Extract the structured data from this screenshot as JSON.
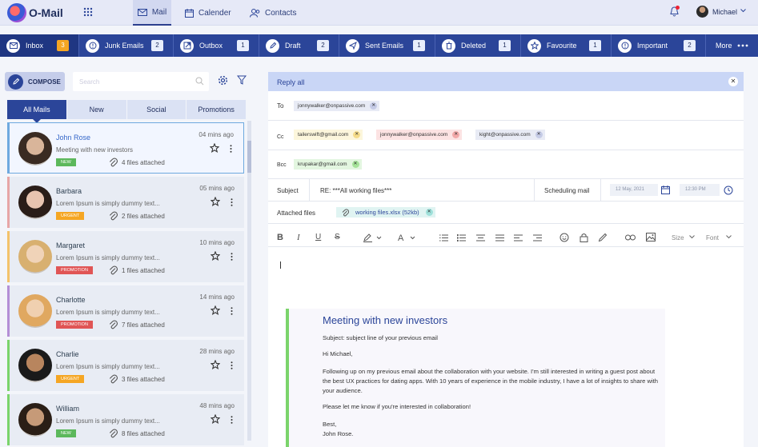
{
  "app": {
    "name": "O-Mail"
  },
  "nav": {
    "tabs": [
      {
        "label": "Mail",
        "icon": "mail-icon"
      },
      {
        "label": "Calender",
        "icon": "calendar-icon"
      },
      {
        "label": "Contacts",
        "icon": "contacts-icon"
      }
    ],
    "active": "Mail"
  },
  "user": {
    "name": "Michael"
  },
  "folders": [
    {
      "label": "Inbox",
      "count": "3",
      "icon": "inbox-icon"
    },
    {
      "label": "Junk Emails",
      "count": "2",
      "icon": "junk-icon"
    },
    {
      "label": "Outbox",
      "count": "1",
      "icon": "outbox-icon"
    },
    {
      "label": "Draft",
      "count": "2",
      "icon": "draft-icon"
    },
    {
      "label": "Sent Emails",
      "count": "1",
      "icon": "sent-icon"
    },
    {
      "label": "Deleted",
      "count": "1",
      "icon": "trash-icon"
    },
    {
      "label": "Favourite",
      "count": "1",
      "icon": "star-icon"
    },
    {
      "label": "Important",
      "count": "2",
      "icon": "important-icon"
    },
    {
      "label": "More",
      "icon": "more-dots-icon"
    }
  ],
  "left": {
    "compose_label": "COMPOSE",
    "search_placeholder": "Search",
    "tabs": [
      "All Mails",
      "New",
      "Social",
      "Promotions"
    ],
    "active_tab": "All Mails"
  },
  "emails": [
    {
      "name": "John Rose",
      "time": "04 mins ago",
      "preview": "Meeting with new investors",
      "badge": "NEW",
      "badge_color": "#5cb85c",
      "attachments": "4 files attached",
      "accent": "#6ea9df"
    },
    {
      "name": "Barbara",
      "time": "05 mins ago",
      "preview": "Lorem Ipsum is simply dummy text...",
      "badge": "URGENT",
      "badge_color": "#f5a623",
      "attachments": "2 files attached",
      "accent": "#e7a6a6"
    },
    {
      "name": "Margaret",
      "time": "10 mins ago",
      "preview": "Lorem Ipsum is simply dummy text...",
      "badge": "PROMOTION",
      "badge_color": "#e05555",
      "attachments": "1 files attached",
      "accent": "#f3c26b"
    },
    {
      "name": "Charlotte",
      "time": "14 mins ago",
      "preview": "Lorem Ipsum is simply dummy text...",
      "badge": "PROMOTION",
      "badge_color": "#e05555",
      "attachments": "7 files attached",
      "accent": "#b48fd6"
    },
    {
      "name": "Charlie",
      "time": "28 mins ago",
      "preview": "Lorem Ipsum is simply dummy text...",
      "badge": "URGENT",
      "badge_color": "#f5a623",
      "attachments": "3 files attached",
      "accent": "#7bd46b"
    },
    {
      "name": "William",
      "time": "48 mins ago",
      "preview": "Lorem Ipsum is simply dummy text...",
      "badge": "NEW",
      "badge_color": "#5cb85c",
      "attachments": "8 files attached",
      "accent": "#7bd46b"
    }
  ],
  "compose": {
    "header": "Reply all",
    "to_label": "To",
    "to": [
      {
        "email": "jonnywalker@onpassive.com",
        "bg": "#e8ebf5",
        "x": "#c5cbe6"
      }
    ],
    "cc_label": "Cc",
    "cc": [
      {
        "email": "tailerswift@gmail.com",
        "bg": "#fcf6dc",
        "x": "#f5dc8a"
      },
      {
        "email": "jonnywalker@onpassive.com",
        "bg": "#fce3e3",
        "x": "#f3a9a9"
      },
      {
        "email": "kight@onpassive.com",
        "bg": "#e8ebf5",
        "x": "#c5cbe6"
      }
    ],
    "bcc_label": "Bcc",
    "bcc": [
      {
        "email": "krupakar@gmail.com",
        "bg": "#e3f6e0",
        "x": "#a6e39a"
      }
    ],
    "subject_label": "Subject",
    "subject": "RE: ***All working files***",
    "scheduling_label": "Scheduling mail",
    "date_placeholder": "12 May, 2021",
    "time_placeholder": "12:30 PM",
    "attached_label": "Attached files",
    "attachment": "working files.xlsx (52kb)",
    "size_label": "Size",
    "font_label": "Font"
  },
  "quoted": {
    "title": "Meeting with new investors",
    "subject_line": "Subject: subject line of your previous email",
    "greeting": "Hi Michael,",
    "body": "Following up on my previous email about the collaboration with your website. I'm still interested in writing a guest post about the best UX practices for dating apps. With 10 years of experience in the mobile industry, I have a lot of insights to share with your audience.",
    "ask": "Please let me know if you're interested in collaboration!",
    "signoff": "Best,",
    "signature": "John Rose."
  }
}
